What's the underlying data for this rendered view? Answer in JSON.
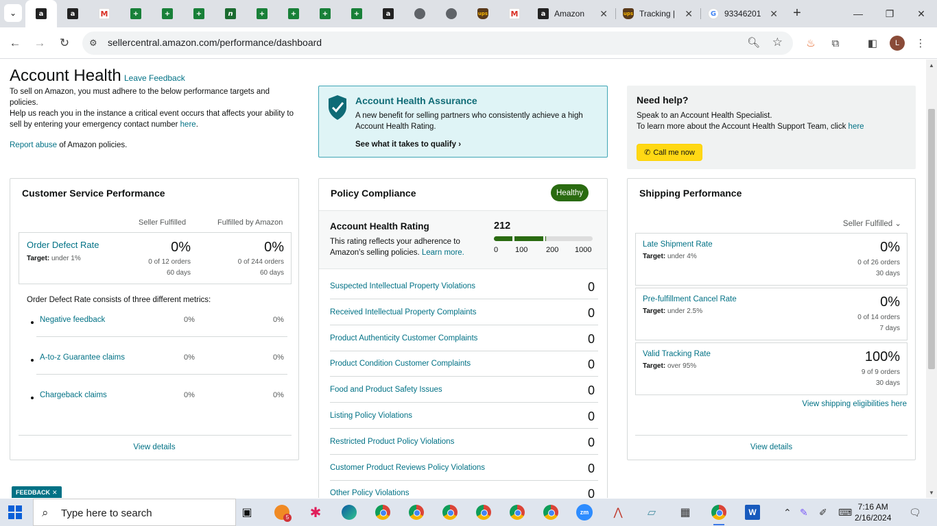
{
  "browser": {
    "pinned_tabs": [
      {
        "icon": "amazon-icon",
        "glyph": "a",
        "style": "amz"
      },
      {
        "icon": "amazon-icon",
        "glyph": "a",
        "style": "amz"
      },
      {
        "icon": "gmail-icon",
        "glyph": "M",
        "style": "gmail"
      },
      {
        "icon": "sheets-icon",
        "glyph": "+",
        "style": "sheet"
      },
      {
        "icon": "sheets-icon",
        "glyph": "+",
        "style": "sheet"
      },
      {
        "icon": "sheets-icon",
        "glyph": "+",
        "style": "sheet"
      },
      {
        "icon": "green-app-icon",
        "glyph": "n",
        "style": "green"
      },
      {
        "icon": "sheets-icon",
        "glyph": "+",
        "style": "sheet"
      },
      {
        "icon": "sheets-icon",
        "glyph": "+",
        "style": "sheet"
      },
      {
        "icon": "sheets-icon",
        "glyph": "+",
        "style": "sheet"
      },
      {
        "icon": "sheets-icon",
        "glyph": "+",
        "style": "sheet"
      },
      {
        "icon": "amazon-icon",
        "glyph": "a",
        "style": "amz"
      },
      {
        "icon": "globe-icon",
        "glyph": "",
        "style": "globe"
      },
      {
        "icon": "globe-icon",
        "glyph": "",
        "style": "globe"
      },
      {
        "icon": "ups-icon",
        "glyph": "ups",
        "style": "ups"
      },
      {
        "icon": "gmail-icon",
        "glyph": "M",
        "style": "gmail"
      }
    ],
    "tabs": [
      {
        "title": "Amazon",
        "icon": "amazon-icon"
      },
      {
        "title": "Tracking |",
        "icon": "ups-icon"
      },
      {
        "title": "93346201",
        "icon": "google-icon"
      }
    ],
    "url": "sellercentral.amazon.com/performance/dashboard",
    "profile_initial": "L"
  },
  "header": {
    "title": "Account Health",
    "leave_feedback": "Leave Feedback",
    "intro_line1": "To sell on Amazon, you must adhere to the below performance targets and policies.",
    "intro_line2_pre": "Help us reach you in the instance a critical event occurs that affects your ability to sell by entering your emergency contact number ",
    "intro_line2_link": "here",
    "intro_line2_post": ".",
    "report_link": "Report abuse",
    "report_post": " of Amazon policies."
  },
  "assurance": {
    "title": "Account Health Assurance",
    "desc": "A new benefit for selling partners who consistently achieve a high Account Health Rating.",
    "cta": "See what it takes to qualify"
  },
  "help": {
    "title": "Need help?",
    "line1": "Speak to an Account Health Specialist.",
    "line2_pre": "To learn more about the Account Health Support Team, click ",
    "line2_link": "here",
    "call_button": "Call me now"
  },
  "customer_service": {
    "title": "Customer Service Performance",
    "col_seller": "Seller Fulfilled",
    "col_fba": "Fulfilled by Amazon",
    "odr": {
      "name": "Order Defect Rate",
      "target_label": "Target:",
      "target_value": "under 1%",
      "seller_pct": "0%",
      "seller_orders": "0 of 12 orders",
      "seller_days": "60 days",
      "fba_pct": "0%",
      "fba_orders": "0 of 244 orders",
      "fba_days": "60 days"
    },
    "consists": "Order Defect Rate consists of three different metrics:",
    "metrics": [
      {
        "name": "Negative feedback",
        "seller": "0%",
        "fba": "0%"
      },
      {
        "name": "A-to-z Guarantee claims",
        "seller": "0%",
        "fba": "0%"
      },
      {
        "name": "Chargeback claims",
        "seller": "0%",
        "fba": "0%"
      }
    ],
    "view_details": "View details"
  },
  "policy": {
    "title": "Policy Compliance",
    "badge": "Healthy",
    "ahr_title": "Account Health Rating",
    "ahr_desc_pre": "This rating reflects your adherence to Amazon's selling policies. ",
    "ahr_desc_link": "Learn more.",
    "score": "212",
    "score_value": 212,
    "ticks": [
      "0",
      "100",
      "200",
      "1000"
    ],
    "rows": [
      {
        "name": "Suspected Intellectual Property Violations",
        "count": "0"
      },
      {
        "name": "Received Intellectual Property Complaints",
        "count": "0"
      },
      {
        "name": "Product Authenticity Customer Complaints",
        "count": "0"
      },
      {
        "name": "Product Condition Customer Complaints",
        "count": "0"
      },
      {
        "name": "Food and Product Safety Issues",
        "count": "0"
      },
      {
        "name": "Listing Policy Violations",
        "count": "0"
      },
      {
        "name": "Restricted Product Policy Violations",
        "count": "0"
      },
      {
        "name": "Customer Product Reviews Policy Violations",
        "count": "0"
      },
      {
        "name": "Other Policy Violations",
        "count": "0"
      }
    ]
  },
  "shipping": {
    "title": "Shipping Performance",
    "selector": "Seller Fulfilled",
    "metrics": [
      {
        "name": "Late Shipment Rate",
        "target_label": "Target:",
        "target_value": "under 4%",
        "pct": "0%",
        "orders": "0 of 26 orders",
        "days": "30 days"
      },
      {
        "name": "Pre-fulfillment Cancel Rate",
        "target_label": "Target:",
        "target_value": "under 2.5%",
        "pct": "0%",
        "orders": "0 of 14 orders",
        "days": "7 days"
      },
      {
        "name": "Valid Tracking Rate",
        "target_label": "Target:",
        "target_value": "over 95%",
        "pct": "100%",
        "orders": "9 of 9 orders",
        "days": "30 days"
      }
    ],
    "eligibilities": "View shipping eligibilities here",
    "view_details": "View details"
  },
  "feedback_tab": "FEEDBACK",
  "taskbar": {
    "search_placeholder": "Type here to search",
    "time": "7:16 AM",
    "date": "2/16/2024",
    "badge_count": "5"
  },
  "colors": {
    "link": "#007185",
    "healthy": "#2a6b11",
    "assurance_bg": "#dff4f6",
    "call_button": "#ffd814"
  }
}
